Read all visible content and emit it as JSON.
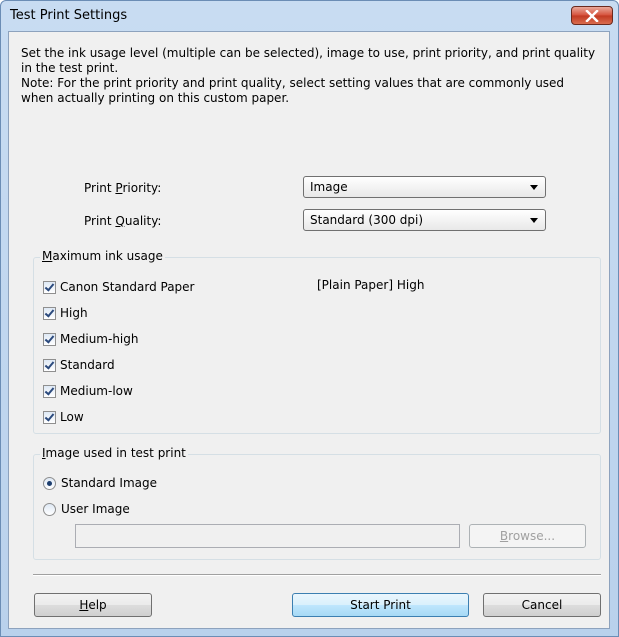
{
  "window": {
    "title": "Test Print Settings",
    "close_icon": "close-x-icon"
  },
  "description": {
    "line1": "Set the ink usage level (multiple can be selected), image to use, print priority, and print quality in the test print.",
    "line2": "Note: For the print priority and print quality, select setting values that are commonly used when actually printing on this custom paper."
  },
  "print_priority": {
    "label_pre": "Print ",
    "label_key": "P",
    "label_post": "riority:",
    "value": "Image"
  },
  "print_quality": {
    "label_pre": "Print ",
    "label_key": "Q",
    "label_post": "uality:",
    "value": "Standard (300 dpi)"
  },
  "ink_group": {
    "title_key": "M",
    "title_rest": "aximum ink usage",
    "paper_label": "[Plain Paper] High",
    "items": [
      {
        "label": "Canon Standard Paper",
        "checked": true
      },
      {
        "label": "High",
        "checked": true
      },
      {
        "label": "Medium-high",
        "checked": true
      },
      {
        "label": "Standard",
        "checked": true
      },
      {
        "label": "Medium-low",
        "checked": true
      },
      {
        "label": "Low",
        "checked": true
      }
    ]
  },
  "image_group": {
    "title_key": "I",
    "title_rest": "mage used in test print",
    "options": [
      {
        "label": "Standard Image",
        "selected": true
      },
      {
        "label": "User Image",
        "selected": false
      }
    ],
    "path_value": "",
    "browse_key": "B",
    "browse_rest": "rowse..."
  },
  "buttons": {
    "help_key": "H",
    "help_rest": "elp",
    "start_print": "Start Print",
    "cancel": "Cancel"
  }
}
